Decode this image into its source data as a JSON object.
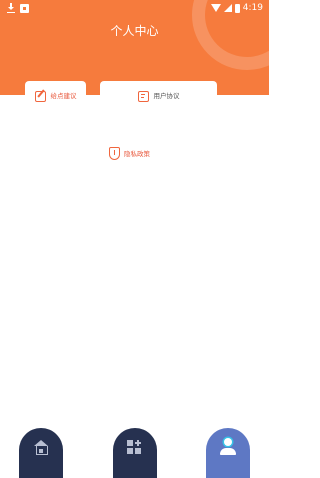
{
  "status_bar": {
    "time": "4:19",
    "icons": [
      "download-icon",
      "notification-icon",
      "wifi-icon",
      "signal-icon",
      "battery-icon"
    ]
  },
  "header": {
    "title": "个人中心",
    "background_color": "#f67b3d"
  },
  "tabs": [
    {
      "label": "给点建议",
      "icon": "edit-icon"
    },
    {
      "label": "用户协议",
      "icon": "document-icon"
    }
  ],
  "privacy": {
    "label": "隐私政策",
    "icon": "shield-icon",
    "accent_color": "#e8573b"
  },
  "bottom_nav": {
    "items": [
      {
        "icon": "home-icon",
        "active": false
      },
      {
        "icon": "apps-icon",
        "active": false
      },
      {
        "icon": "user-icon",
        "active": true
      }
    ],
    "inactive_color": "#263150",
    "active_color": "#5e78c4"
  }
}
